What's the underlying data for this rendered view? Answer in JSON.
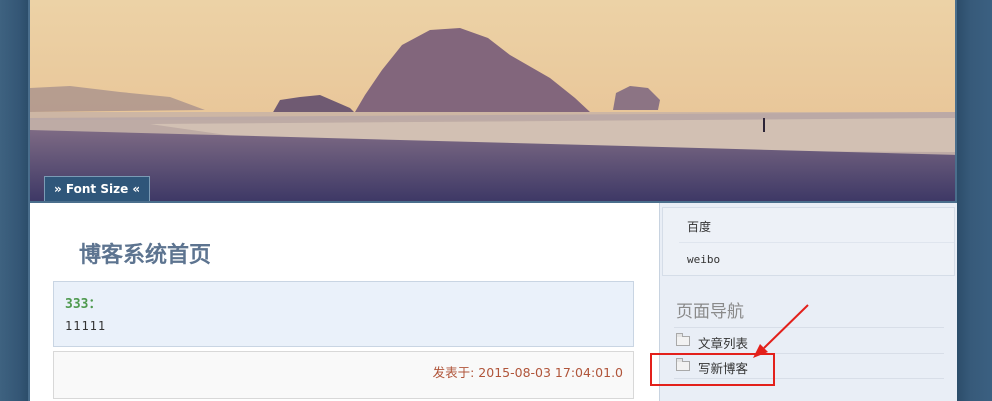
{
  "header": {
    "font_size_label": "» Font Size «"
  },
  "main": {
    "page_title": "博客系统首页",
    "post": {
      "title": "333：",
      "body": "11111",
      "date": "发表于: 2015-08-03 17:04:01.0"
    }
  },
  "sidebar": {
    "links": [
      {
        "label": "百度"
      },
      {
        "label": "weibo"
      }
    ],
    "nav_heading": "页面导航",
    "nav_items": [
      {
        "label": "文章列表",
        "icon": "folder-icon"
      },
      {
        "label": "写新博客",
        "icon": "folder-icon"
      }
    ]
  },
  "colors": {
    "page_background": "#375a7a",
    "title": "#5d7490",
    "post_title": "#4f9a4f",
    "date": "#b0553a",
    "annotation": "#e3201b"
  }
}
